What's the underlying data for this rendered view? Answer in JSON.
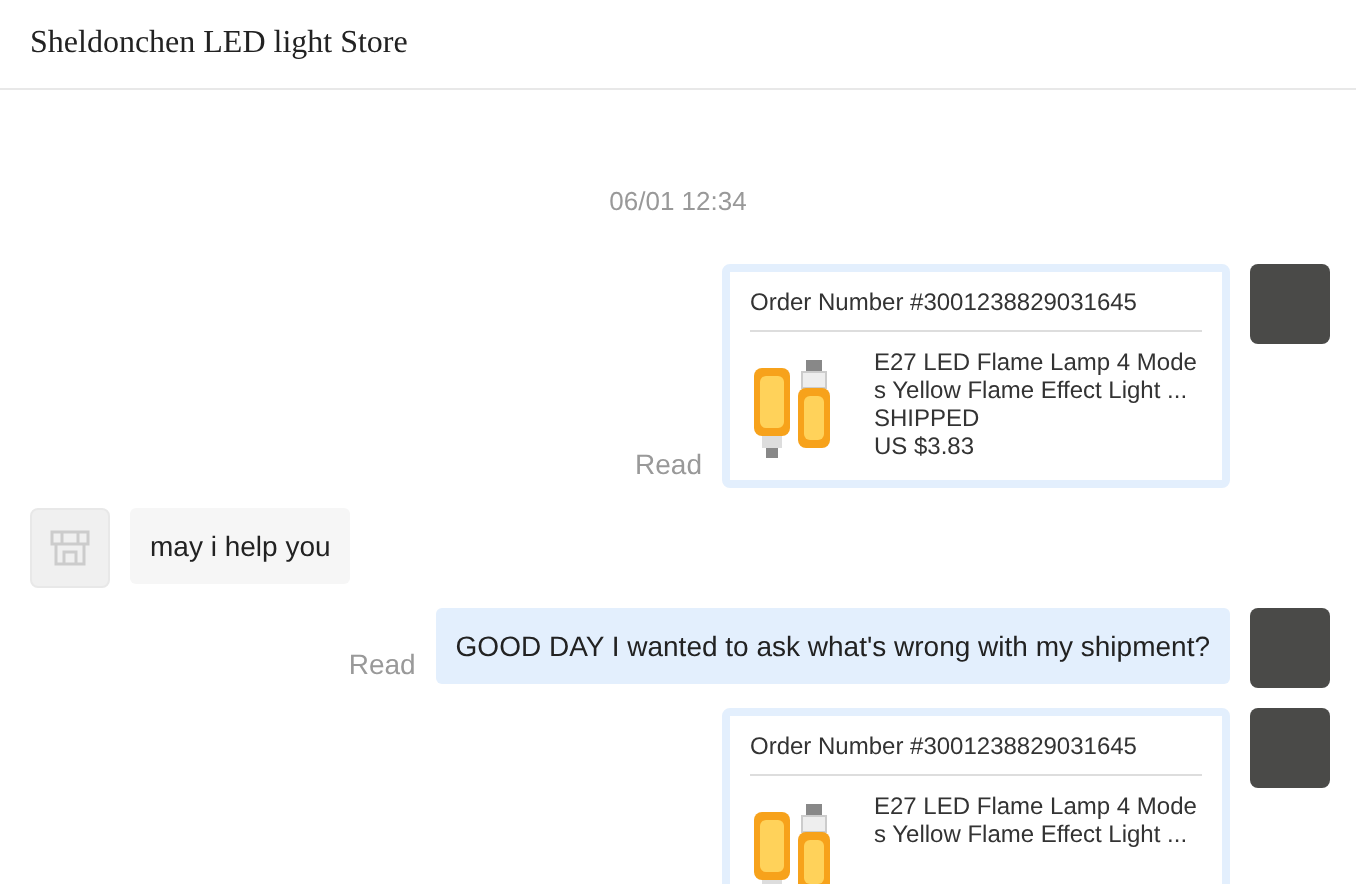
{
  "window": {
    "title": "Sheldonchen LED light Store"
  },
  "timestamp": "06/01 12:34",
  "messages": [
    {
      "kind": "order",
      "outgoing": true,
      "status": "Read",
      "order_number": "Order Number #3001238829031645",
      "product": "E27 LED Flame Lamp 4 Modes Yellow Flame Effect Light ...",
      "shipping": "SHIPPED",
      "price": "US $3.83"
    },
    {
      "kind": "text",
      "outgoing": false,
      "text": "may i help you"
    },
    {
      "kind": "text",
      "outgoing": true,
      "status": "Read",
      "text": "GOOD DAY I wanted to ask what's wrong with my shipment?"
    },
    {
      "kind": "order",
      "outgoing": true,
      "order_number": "Order Number #3001238829031645",
      "product": "E27 LED Flame Lamp 4 Modes Yellow Flame Effect Light ..."
    }
  ]
}
